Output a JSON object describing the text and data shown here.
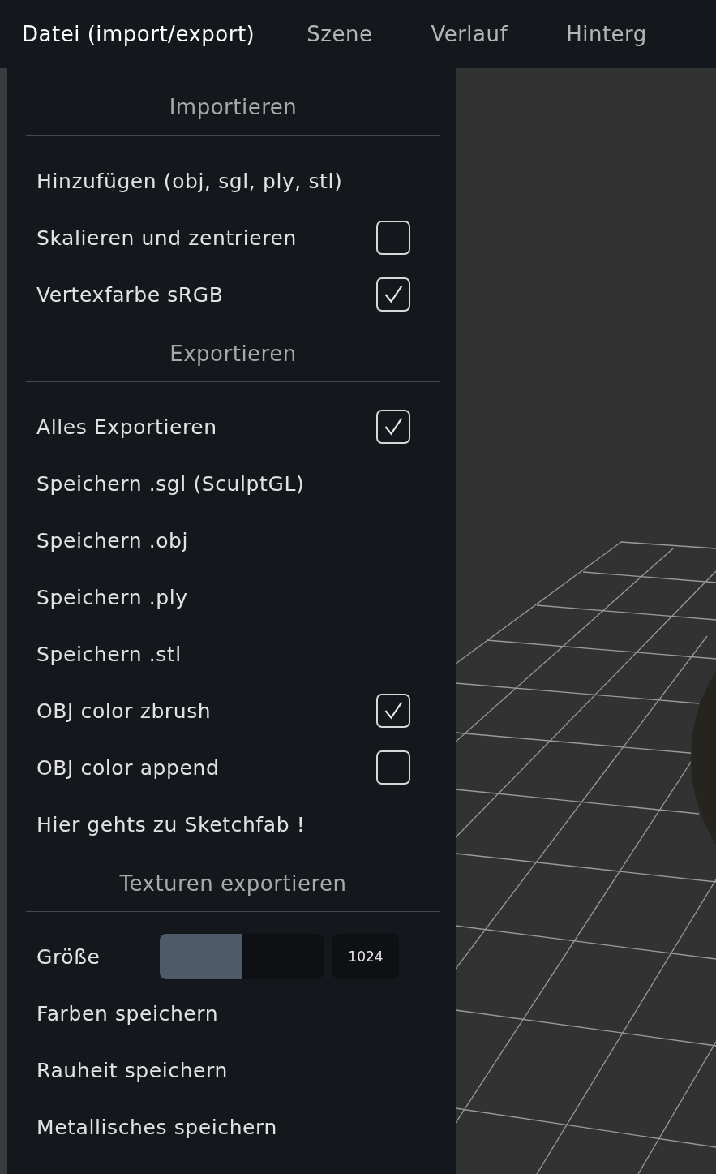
{
  "menu": [
    {
      "label": "Datei (import/export)",
      "selected": true
    },
    {
      "label": "Szene",
      "selected": false
    },
    {
      "label": "Verlauf",
      "selected": false
    },
    {
      "label": "Hinterg",
      "selected": false
    }
  ],
  "panel": {
    "sections": [
      {
        "title": "Importieren",
        "items": [
          {
            "kind": "action",
            "label": "Hinzufügen (obj, sgl, ply, stl)"
          },
          {
            "kind": "checkbox",
            "label": "Skalieren und zentrieren",
            "checked": false
          },
          {
            "kind": "checkbox",
            "label": "Vertexfarbe sRGB",
            "checked": true
          }
        ]
      },
      {
        "title": "Exportieren",
        "items": [
          {
            "kind": "checkbox",
            "label": "Alles Exportieren",
            "checked": true
          },
          {
            "kind": "action",
            "label": "Speichern .sgl (SculptGL)"
          },
          {
            "kind": "action",
            "label": "Speichern .obj"
          },
          {
            "kind": "action",
            "label": "Speichern .ply"
          },
          {
            "kind": "action",
            "label": "Speichern .stl"
          },
          {
            "kind": "checkbox",
            "label": "OBJ color zbrush",
            "checked": true
          },
          {
            "kind": "checkbox",
            "label": "OBJ color append",
            "checked": false
          },
          {
            "kind": "action",
            "label": "Hier gehts zu Sketchfab !"
          }
        ]
      },
      {
        "title": "Texturen exportieren",
        "items": [
          {
            "kind": "slider",
            "label": "Größe",
            "level": 0.5,
            "value": "1024"
          },
          {
            "kind": "action",
            "label": "Farben speichern"
          },
          {
            "kind": "action",
            "label": "Rauheit speichern"
          },
          {
            "kind": "action",
            "label": "Metallisches speichern"
          }
        ]
      }
    ]
  }
}
